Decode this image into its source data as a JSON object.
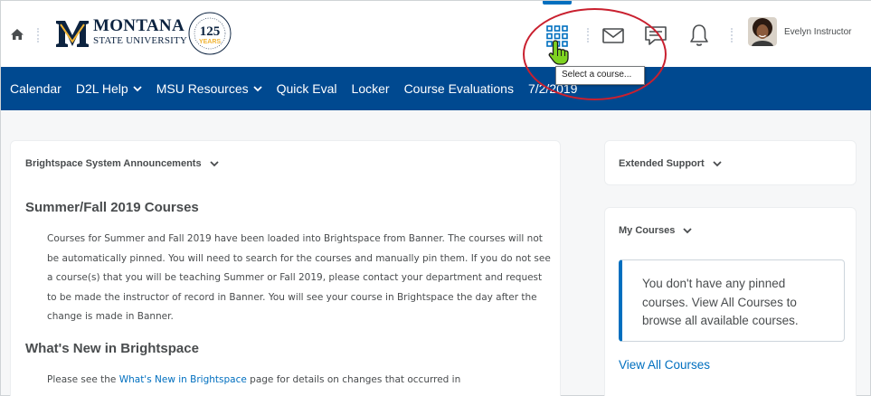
{
  "header": {
    "home_icon": "home-icon",
    "logo": {
      "name_line1": "MONTANA",
      "name_line2": "STATE UNIVERSITY",
      "seal_number": "125",
      "seal_word": "YEARS"
    },
    "icons": {
      "course_selector": "waffle-grid-icon",
      "email": "envelope-icon",
      "discussions": "chat-bubble-icon",
      "notifications": "bell-icon"
    },
    "user_name": "Evelyn Instructor",
    "tooltip": "Select a course...",
    "colors": {
      "nav_background": "#004990",
      "accent": "#006fbf",
      "highlight_ring": "#c9202f"
    }
  },
  "nav": {
    "items": [
      {
        "label": "Calendar",
        "has_menu": false
      },
      {
        "label": "D2L Help",
        "has_menu": true
      },
      {
        "label": "MSU Resources",
        "has_menu": true
      },
      {
        "label": "Quick Eval",
        "has_menu": false
      },
      {
        "label": "Locker",
        "has_menu": false
      },
      {
        "label": "Course Evaluations",
        "has_menu": false
      },
      {
        "label": "7/2/2019",
        "has_menu": false
      }
    ]
  },
  "announcements": {
    "title": "Brightspace System Announcements",
    "section1_heading": "Summer/Fall 2019 Courses",
    "section1_body": "Courses for Summer and Fall 2019 have been loaded into Brightspace from Banner. The courses will not be automatically pinned. You will need to search for the courses and manually pin them. If you do not see a course(s) that you will be teaching Summer or Fall 2019, please contact your department and request to be made the instructor of record in Banner. You will see your course in Brightspace the day after the change is made in Banner.",
    "section2_heading": "What's New in Brightspace",
    "section2_prefix": "Please see the ",
    "section2_link": "What's New in Brightspace",
    "section2_suffix": " page for details on changes that occurred in"
  },
  "extended_support": {
    "title": "Extended Support"
  },
  "my_courses": {
    "title": "My Courses",
    "empty_message": "You don't have any pinned courses. View All Courses to browse all available courses.",
    "view_all_link": "View All Courses"
  }
}
